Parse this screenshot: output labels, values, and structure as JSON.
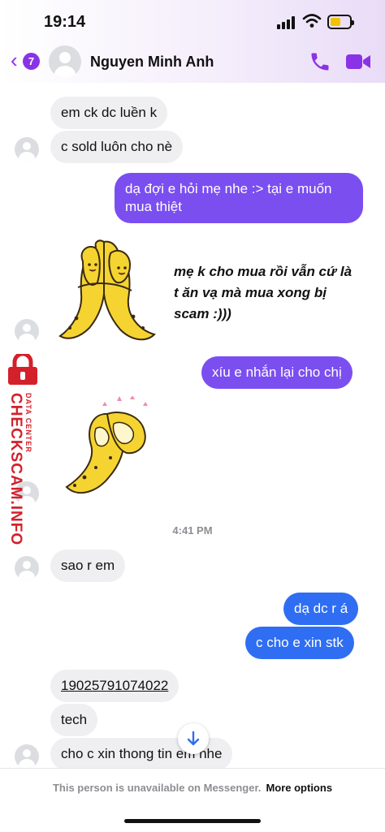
{
  "status": {
    "time": "19:14"
  },
  "header": {
    "back_badge": "7",
    "contact_name": "Nguyen Minh Anh"
  },
  "messages": {
    "m1": "em ck dc luền k",
    "m2": "c sold luôn cho nè",
    "m3": "dạ đợi e hỏi mẹ nhe :> tại e muốn mua thiệt",
    "m4": "mẹ k cho mua rồi vẫn cứ là t ăn vạ mà mua xong bị scam :)))",
    "m5": "xíu e nhắn lại cho chị",
    "time_separator": "4:41 PM",
    "m6": "sao r em",
    "m7": "dạ dc r á",
    "m8": "c cho e xin stk",
    "m9": "19025791074022",
    "m10": "tech",
    "m11": "cho c xin thong tin em nhe"
  },
  "watermark": {
    "brand": "CHECKSCAM.INFO",
    "sub": "DATA CENTER"
  },
  "footer": {
    "unavailable": "This person is unavailable on Messenger.",
    "more_options": "More options"
  },
  "colors": {
    "accent": "#8a33e6",
    "outgoing_purple": "#7b4ef0",
    "outgoing_blue": "#2f6ef3",
    "incoming": "#efeff1",
    "sticker_yellow": "#f5d431"
  },
  "icons": [
    "back-chevron-icon",
    "phone-icon",
    "video-camera-icon",
    "scroll-down-arrow-icon",
    "lock-icon",
    "banana-sticker"
  ]
}
